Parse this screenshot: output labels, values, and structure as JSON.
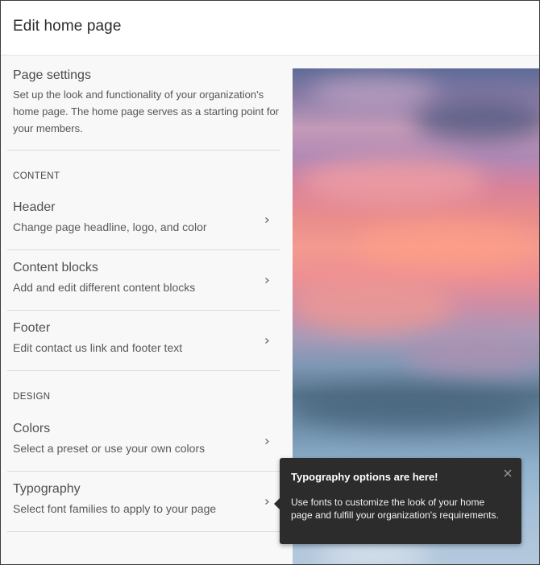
{
  "header": {
    "title": "Edit home page"
  },
  "intro": {
    "title": "Page settings",
    "description": "Set up the look and functionality of your organization's home page. The home page serves as a starting point for your members."
  },
  "sections": {
    "content_label": "CONTENT",
    "design_label": "DESIGN"
  },
  "items": [
    {
      "name": "Header",
      "description": "Change page headline, logo, and color"
    },
    {
      "name": "Content blocks",
      "description": "Add and edit different content blocks"
    },
    {
      "name": "Footer",
      "description": "Edit contact us link and footer text"
    },
    {
      "name": "Colors",
      "description": "Select a preset or use your own colors"
    },
    {
      "name": "Typography",
      "description": "Select font families to apply to your page"
    }
  ],
  "tooltip": {
    "title": "Typography options are here!",
    "body": "Use fonts to customize the look of your home page and fulfill your organization's requirements."
  },
  "icons": {
    "chevron": "chevron-right-icon",
    "close": "close-icon"
  }
}
